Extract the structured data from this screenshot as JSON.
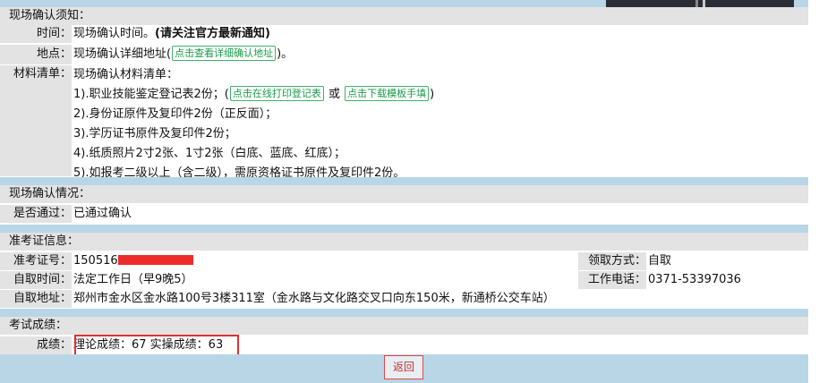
{
  "notice": {
    "title": "现场确认须知：",
    "time_label": "时间：",
    "time_value": "现场确认时间。",
    "time_note": "(请关注官方最新通知)",
    "place_label": "地点：",
    "place_value_pre": "现场确认详细地址(",
    "place_link": "点击查看详细确认地址",
    "place_value_post": ")。",
    "materials_label": "材料清单：",
    "materials_intro": "现场确认材料清单：",
    "item1_pre": "1).职业技能鉴定登记表2份；(",
    "item1_link1": "点击在线打印登记表",
    "item1_or": "或",
    "item1_link2": "点击下载模板手填",
    "item1_post": ")",
    "item2": "2).身份证原件及复印件2份（正反面）；",
    "item3": "3).学历证书原件及复印件2份；",
    "item4": "4).纸质照片2寸2张、1寸2张（白底、蓝底、红底）；",
    "item5": "5).如报考二级以上（含二级），需原资格证书原件及复印件2份。"
  },
  "confirm": {
    "title": "现场确认情况：",
    "passed_label": "是否通过：",
    "passed_value": "已通过确认"
  },
  "ticket": {
    "title": "准考证信息：",
    "number_label": "准考证号：",
    "number_value": "150516",
    "pickup_method_label": "领取方式：",
    "pickup_method_value": "自取",
    "pickup_time_label": "自取时间：",
    "pickup_time_value": "法定工作日（早9晚5）",
    "phone_label": "工作电话：",
    "phone_value": "0371-53397036",
    "address_label": "自取地址：",
    "address_value": "郑州市金水区金水路100号3楼311室（金水路与文化路交叉口向东150米，新通桥公交车站）"
  },
  "score": {
    "title": "考试成绩：",
    "label": "成绩：",
    "value": "理论成绩：67 实操成绩：63"
  },
  "back_button": "返回",
  "colors": {
    "band": "#b8d6e6",
    "section_bg": "#e3e3e3",
    "link_green": "#1a9a4a",
    "highlight_red": "#e03030"
  }
}
